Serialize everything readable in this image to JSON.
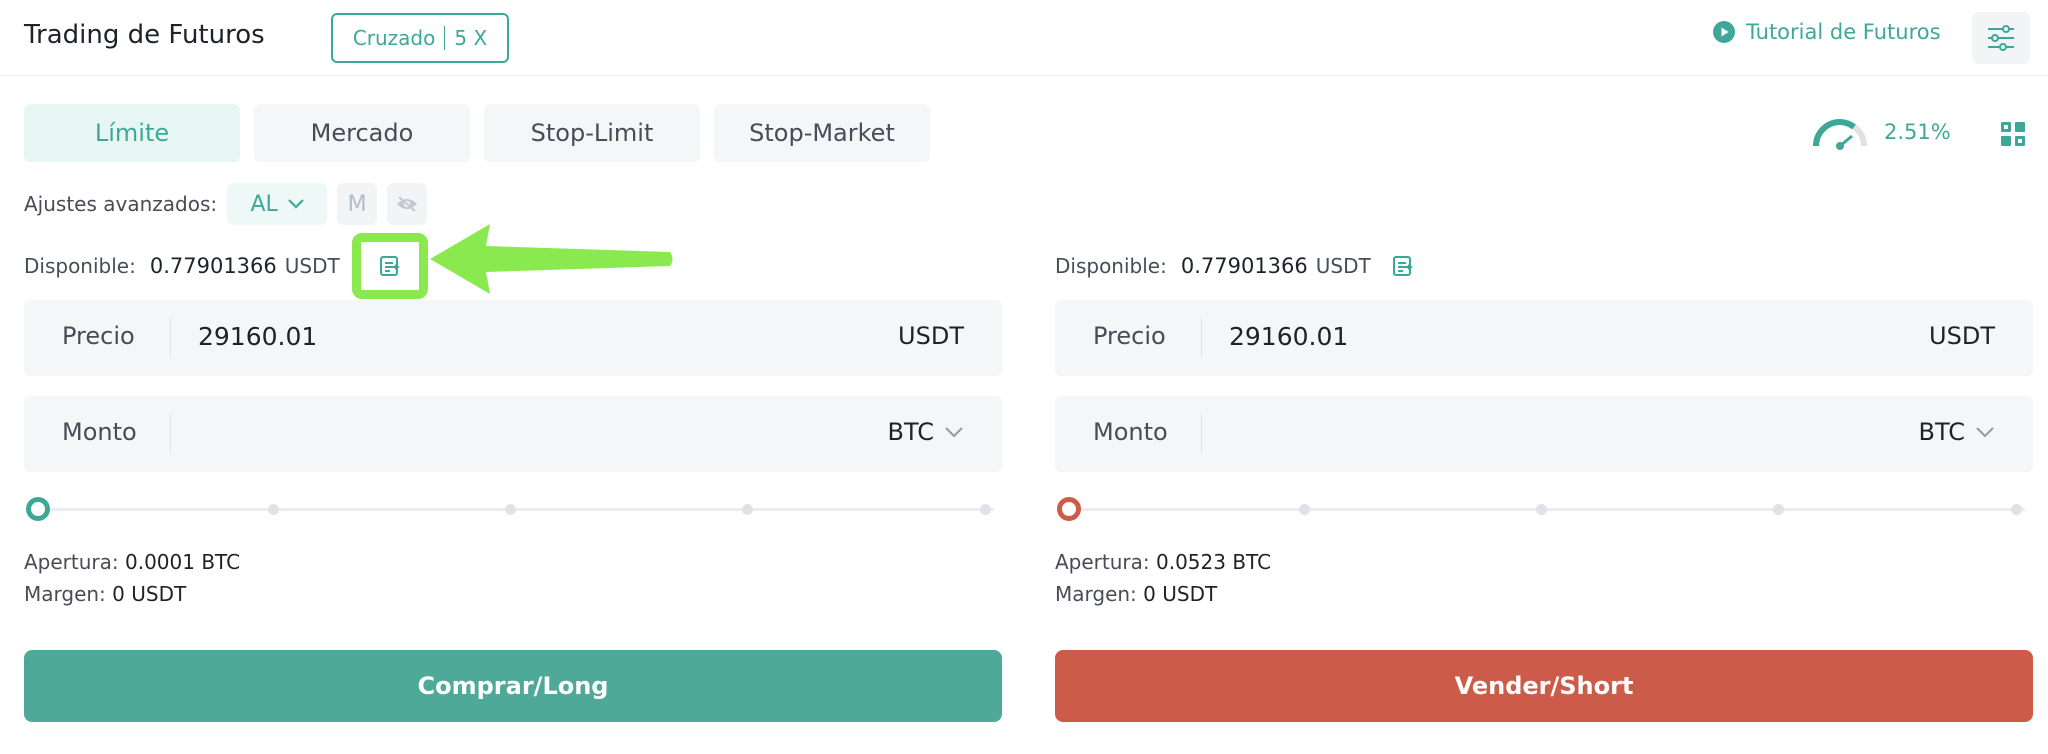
{
  "header": {
    "title": "Trading de Futuros",
    "margin_mode": "Cruzado",
    "leverage": "5 X",
    "tutorial_label": "Tutorial de Futuros"
  },
  "tabs": [
    {
      "label": "Límite",
      "active": true
    },
    {
      "label": "Mercado",
      "active": false
    },
    {
      "label": "Stop-Limit",
      "active": false
    },
    {
      "label": "Stop-Market",
      "active": false
    }
  ],
  "risk_gauge": {
    "value": "2.51%"
  },
  "advanced": {
    "label": "Ajustes avanzados:",
    "al_label": "AL",
    "m_label": "M"
  },
  "buy_panel": {
    "available_label": "Disponible:",
    "available_value": "0.77901366",
    "available_unit": "USDT",
    "price_label": "Precio",
    "price_value": "29160.01",
    "price_unit": "USDT",
    "amount_label": "Monto",
    "amount_unit": "BTC",
    "apertura_label": "Apertura:",
    "apertura_value": "0.0001 BTC",
    "margen_label": "Margen:",
    "margen_value": "0 USDT",
    "action_label": "Comprar/Long",
    "slider_percent": 0
  },
  "sell_panel": {
    "available_label": "Disponible:",
    "available_value": "0.77901366",
    "available_unit": "USDT",
    "price_label": "Precio",
    "price_value": "29160.01",
    "price_unit": "USDT",
    "amount_label": "Monto",
    "amount_unit": "BTC",
    "apertura_label": "Apertura:",
    "apertura_value": "0.0523 BTC",
    "margen_label": "Margen:",
    "margen_value": "0 USDT",
    "action_label": "Vender/Short",
    "slider_percent": 0
  },
  "colors": {
    "accent": "#3ea898",
    "buy": "#4fa999",
    "sell": "#cc5c49",
    "highlight": "#8ae94f"
  }
}
